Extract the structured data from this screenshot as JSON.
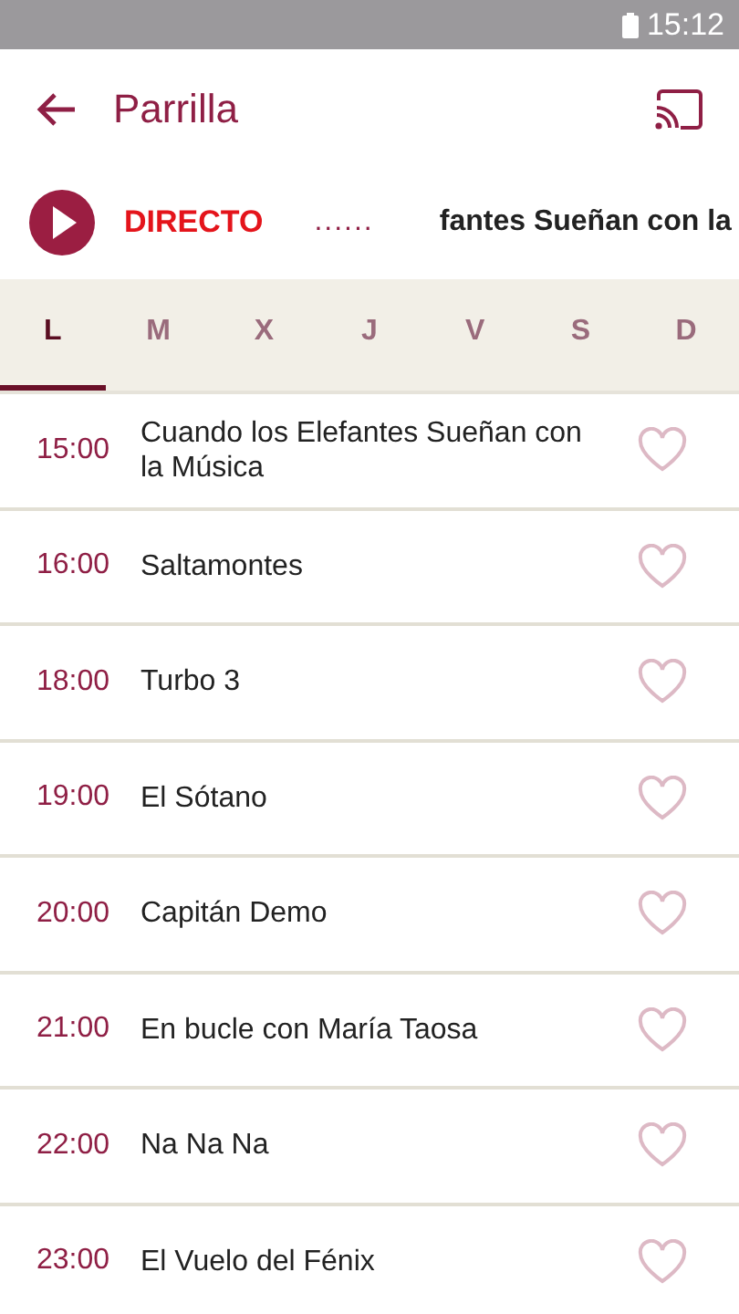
{
  "status_bar": {
    "time": "15:12"
  },
  "app_bar": {
    "title": "Parrilla"
  },
  "live": {
    "label": "DIRECTO",
    "dots": "......",
    "now_playing": "fantes Sueñan con la"
  },
  "days": [
    {
      "label": "L",
      "selected": true
    },
    {
      "label": "M",
      "selected": false
    },
    {
      "label": "X",
      "selected": false
    },
    {
      "label": "J",
      "selected": false
    },
    {
      "label": "V",
      "selected": false
    },
    {
      "label": "S",
      "selected": false
    },
    {
      "label": "D",
      "selected": false
    }
  ],
  "programs": [
    {
      "time": "15:00",
      "title": "Cuando los Elefantes Sueñan con la Música",
      "favorite": false
    },
    {
      "time": "16:00",
      "title": "Saltamontes",
      "favorite": false
    },
    {
      "time": "18:00",
      "title": "Turbo 3",
      "favorite": false
    },
    {
      "time": "19:00",
      "title": "El Sótano",
      "favorite": false
    },
    {
      "time": "20:00",
      "title": "Capitán Demo",
      "favorite": false
    },
    {
      "time": "21:00",
      "title": "En bucle con María Taosa",
      "favorite": false
    },
    {
      "time": "22:00",
      "title": "Na Na Na",
      "favorite": false
    },
    {
      "time": "23:00",
      "title": "El Vuelo del Fénix",
      "favorite": false
    }
  ]
}
